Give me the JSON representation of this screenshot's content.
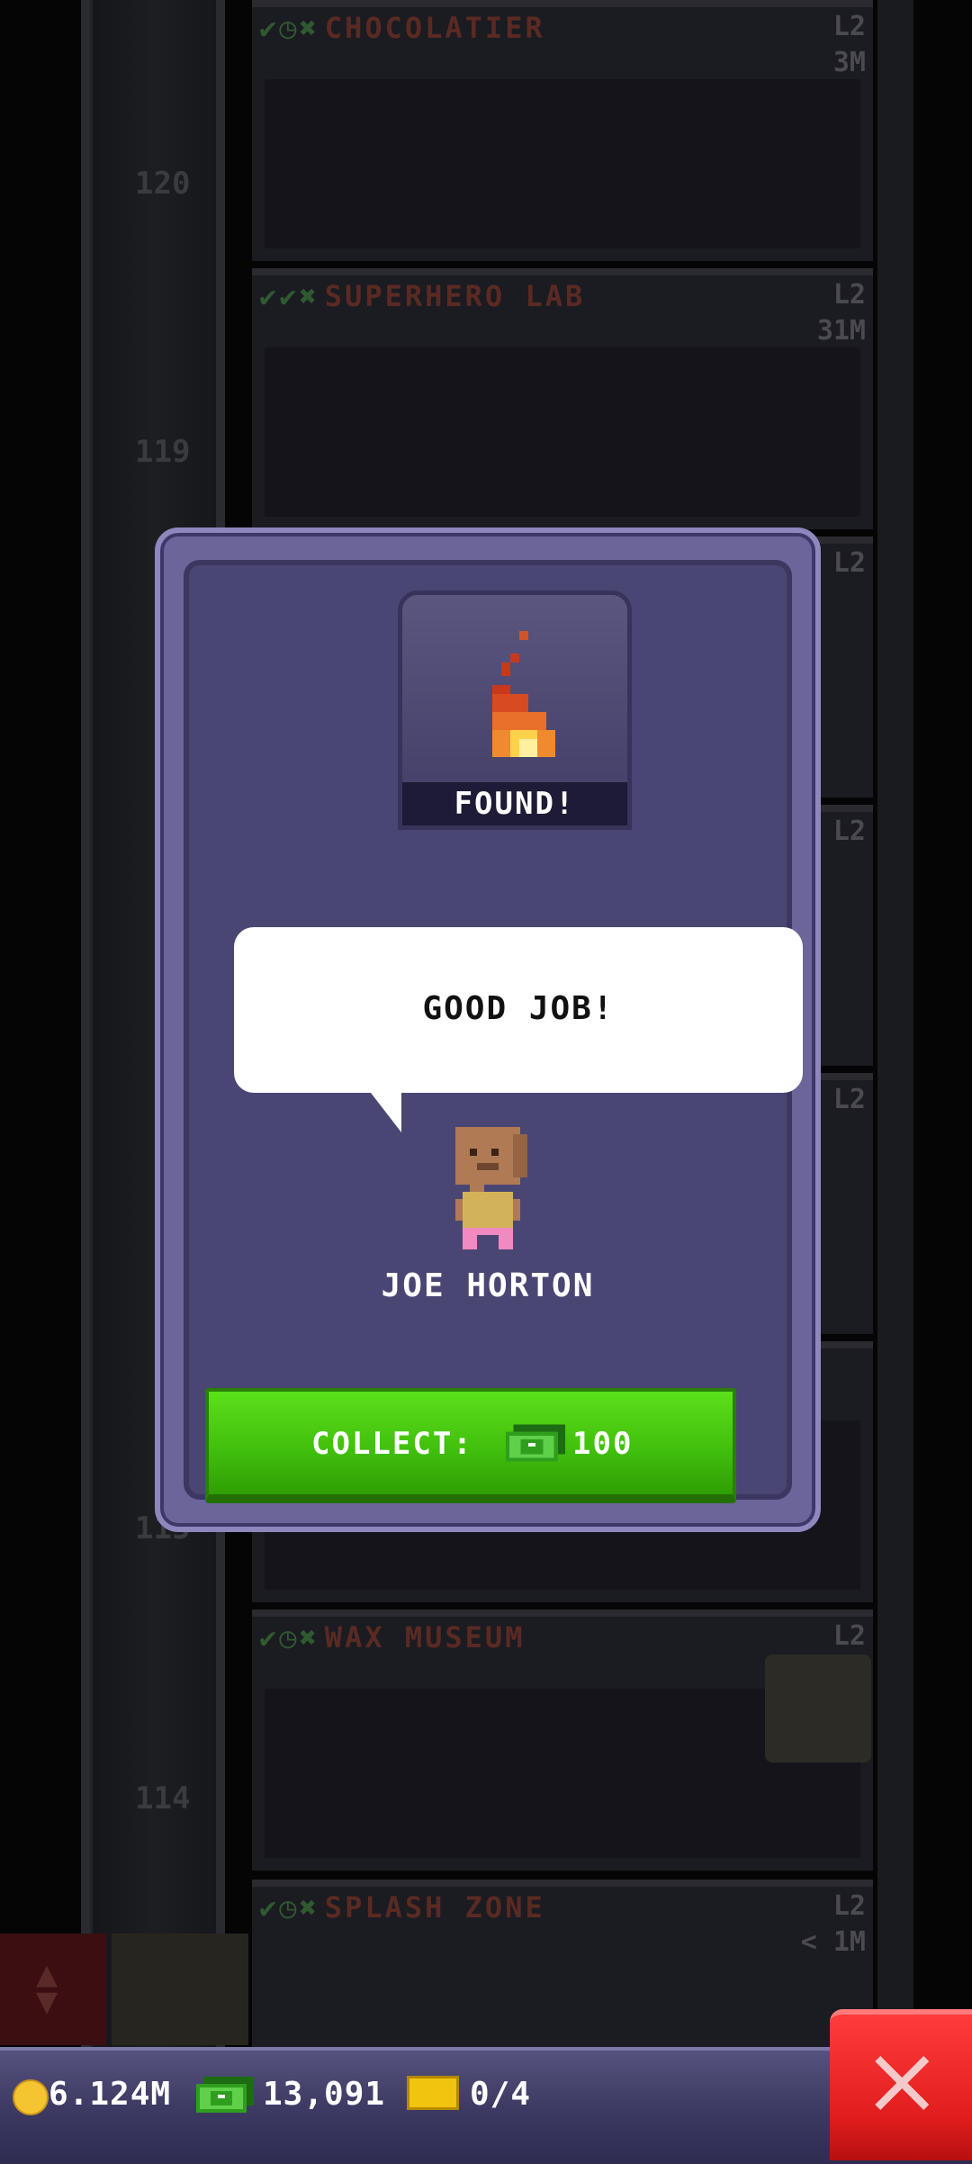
{
  "tower": {
    "floors": [
      {
        "name": "CHOCOLATIER",
        "level": "L2",
        "income": "3M",
        "number": "120"
      },
      {
        "name": "SUPERHERO LAB",
        "level": "L2",
        "income": "31M",
        "number": "119"
      },
      {
        "name": "",
        "level": "L2",
        "income": "",
        "number": ""
      },
      {
        "name": "",
        "level": "L2",
        "income": "",
        "number": ""
      },
      {
        "name": "",
        "level": "L2",
        "income": "",
        "number": ""
      },
      {
        "name": "WAX MUSEUM",
        "level": "L2",
        "income": "",
        "number": "114"
      },
      {
        "name": "SPLASH ZONE",
        "level": "L2",
        "income": "< 1M",
        "number": ""
      }
    ],
    "partial_floor_number": "115"
  },
  "modal": {
    "found_label": "FOUND!",
    "item_icon": "flame-icon",
    "speech": "GOOD JOB!",
    "character_name": "JOE HORTON",
    "collect_label": "COLLECT:",
    "collect_icon": "cash-icon",
    "collect_amount": "100"
  },
  "status_bar": {
    "coins": "6.124M",
    "cash": "13,091",
    "bux": "0/4"
  },
  "colors": {
    "modal_bg": "#4a4673",
    "collect_green": "#3fbd0c",
    "close_red": "#e11d1d"
  }
}
